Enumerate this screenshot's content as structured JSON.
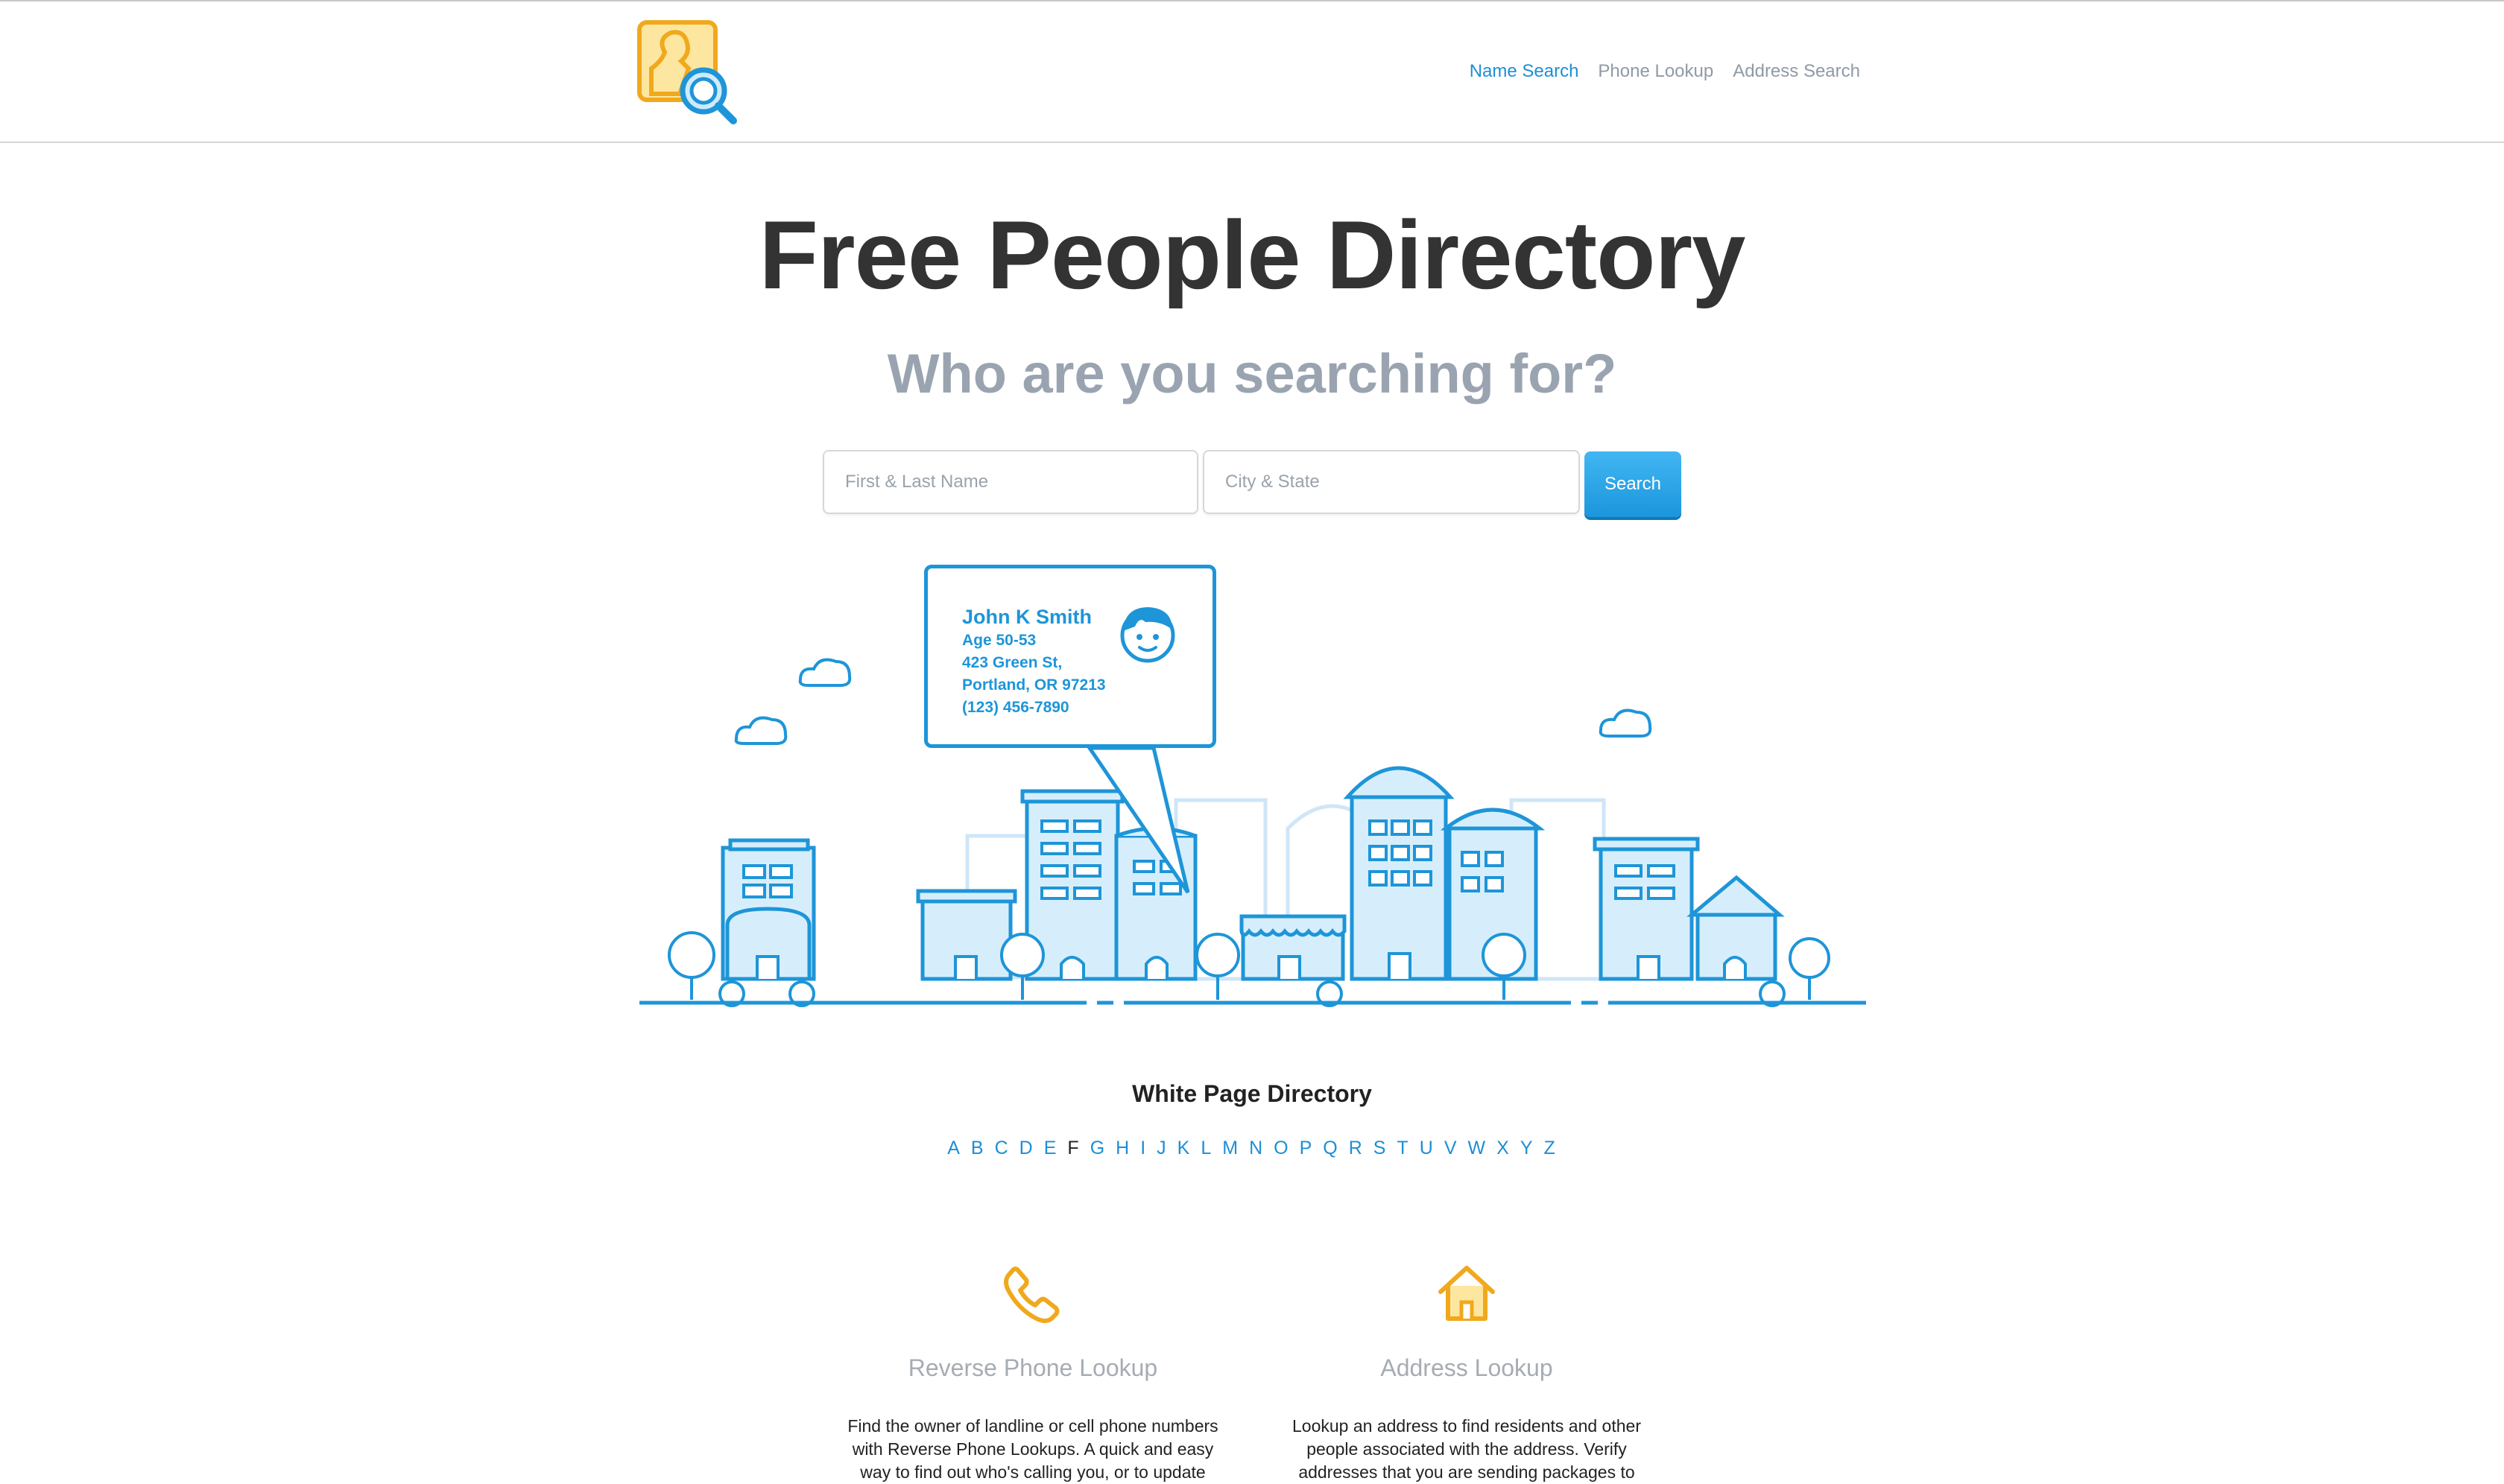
{
  "nav": {
    "name_search": "Name Search",
    "phone_lookup": "Phone Lookup",
    "address_search": "Address Search"
  },
  "hero": {
    "title": "Free People Directory",
    "subtitle": "Who are you searching for?"
  },
  "search": {
    "name_placeholder": "First & Last Name",
    "city_placeholder": "City & State",
    "button_label": "Search"
  },
  "example_card": {
    "name": "John K Smith",
    "age": "Age 50-53",
    "street": "423 Green St,",
    "city": "Portland, OR 97213",
    "phone": "(123) 456-7890"
  },
  "directory": {
    "title": "White Page Directory",
    "letters": [
      "A",
      "B",
      "C",
      "D",
      "E",
      "F",
      "G",
      "H",
      "I",
      "J",
      "K",
      "L",
      "M",
      "N",
      "O",
      "P",
      "Q",
      "R",
      "S",
      "T",
      "U",
      "V",
      "W",
      "X",
      "Y",
      "Z"
    ],
    "current_letter": "F"
  },
  "features": {
    "phone": {
      "icon": "phone-icon",
      "title": "Reverse Phone Lookup",
      "text": "Find the owner of landline or cell phone numbers with Reverse Phone Lookups. A quick and easy way to find out who's calling you, or to update"
    },
    "address": {
      "icon": "house-icon",
      "title": "Address Lookup",
      "text": "Lookup an address to find residents and other people associated with the address. Verify addresses that you are sending packages to"
    }
  },
  "colors": {
    "accent": "#1b8fd6",
    "logo_orange": "#f0a91c",
    "button": "#26a4e8"
  }
}
